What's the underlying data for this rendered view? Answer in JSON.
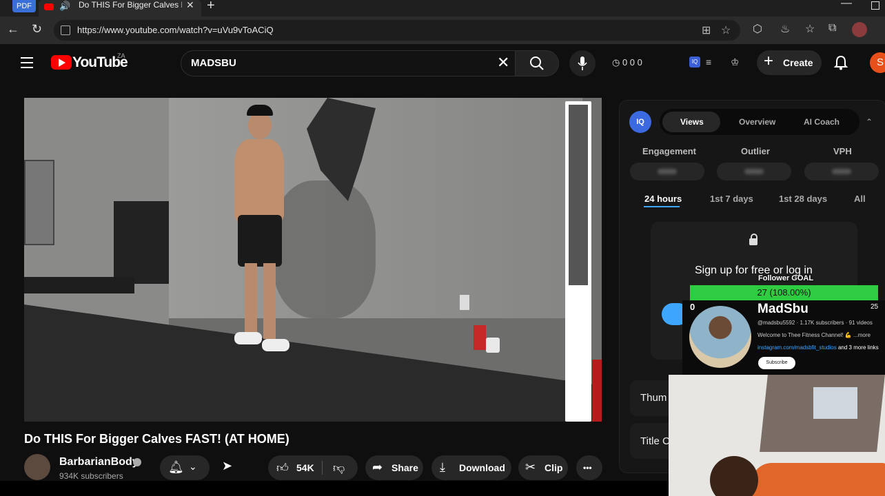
{
  "browser": {
    "pdf_badge": "PDF",
    "tab_title": "Do THIS For Bigger Calves F",
    "new_tab": "+",
    "url": "https://www.youtube.com/watch?v=uVu9vToACiQ"
  },
  "yt_header": {
    "logo_text": "YouTube",
    "country": "ZA",
    "search_query": "MADSBU",
    "stats": "0 0 0",
    "create_label": "Create",
    "avatar_letter": "S"
  },
  "video": {
    "title": "Do THIS For Bigger Calves FAST! (AT HOME)",
    "channel_name": "BarbarianBody",
    "channel_subs": "934K subscribers"
  },
  "actions": {
    "likes": "54K",
    "share": "Share",
    "download": "Download",
    "clip": "Clip",
    "more": "•••"
  },
  "vidiq": {
    "logo": "IQ",
    "tabs": [
      "Views",
      "Overview",
      "AI Coach"
    ],
    "metrics": [
      "Engagement",
      "Outlier",
      "VPH"
    ],
    "ranges": [
      "24 hours",
      "1st 7 days",
      "1st 28 days",
      "All"
    ],
    "locked_text": "Sign up for free or log in",
    "side_labels": [
      "Thum",
      "Title C"
    ]
  },
  "overlay": {
    "goal_label": "Follower GOAL",
    "goal_value": "27 (108.00%)",
    "goal_fraction": 1.08,
    "count_left": "0",
    "count_right": "25",
    "name": "MadSbu",
    "handle": "@madsbu5592 · 1.17K subscribers · 91 videos",
    "description": "Welcome to Thee Fitness Channel! 💪 ...more",
    "link": "instagram.com/madsbfit_studios",
    "link_more": "and 3 more links",
    "subscribe": "Subscribe"
  },
  "colors": {
    "youtube_red": "#ff0000",
    "goal_green": "#2ecc40",
    "link_blue": "#3ea6ff",
    "avatar_orange": "#e8501a"
  }
}
